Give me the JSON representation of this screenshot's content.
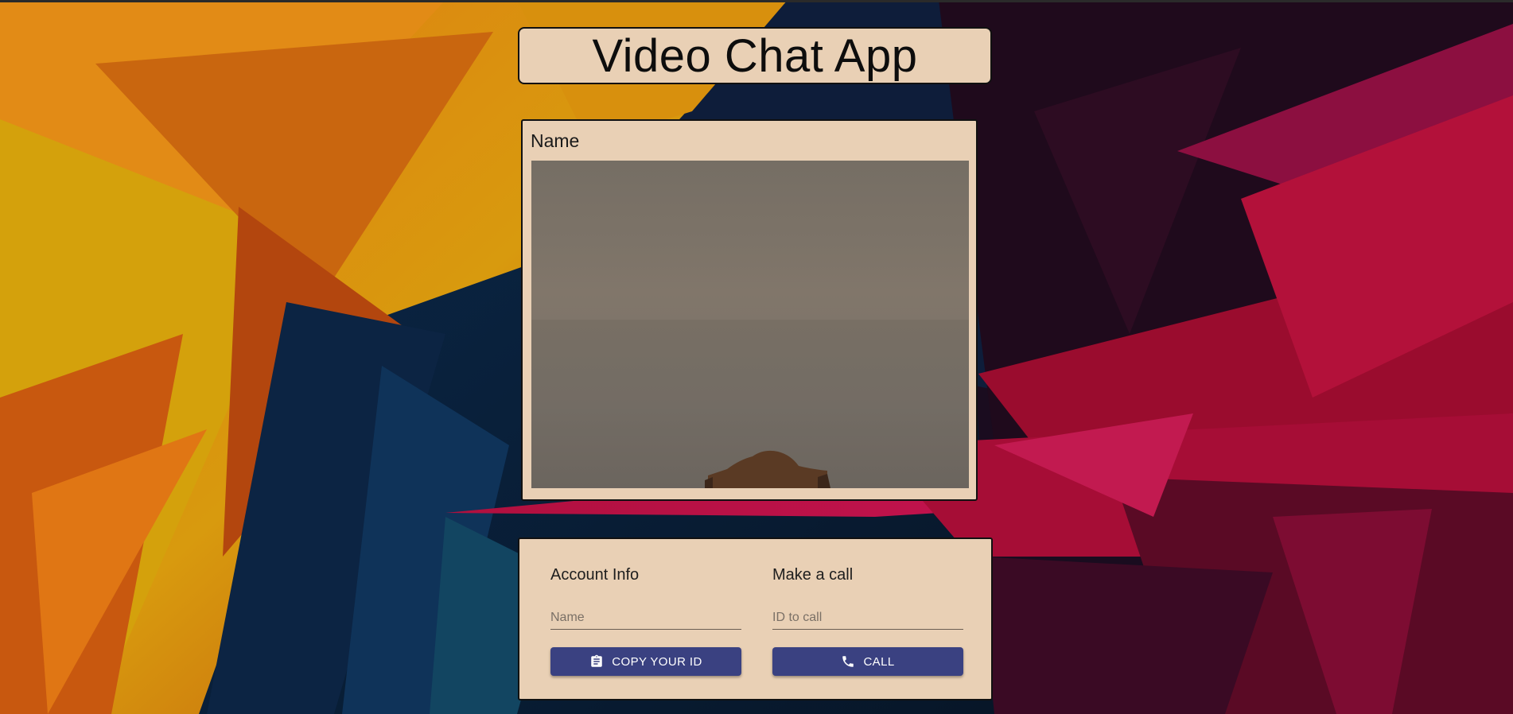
{
  "app": {
    "title": "Video Chat App"
  },
  "video": {
    "name_label": "Name"
  },
  "account_info": {
    "heading": "Account Info",
    "name_placeholder": "Name",
    "copy_button_label": "COPY YOUR ID",
    "copy_icon": "clipboard-icon"
  },
  "make_call": {
    "heading": "Make a call",
    "id_placeholder": "ID to call",
    "call_button_label": "CALL",
    "call_icon": "phone-icon"
  },
  "colors": {
    "card_background": "#e9d0b5",
    "button_background": "#3a4181",
    "button_text": "#ffffff"
  }
}
